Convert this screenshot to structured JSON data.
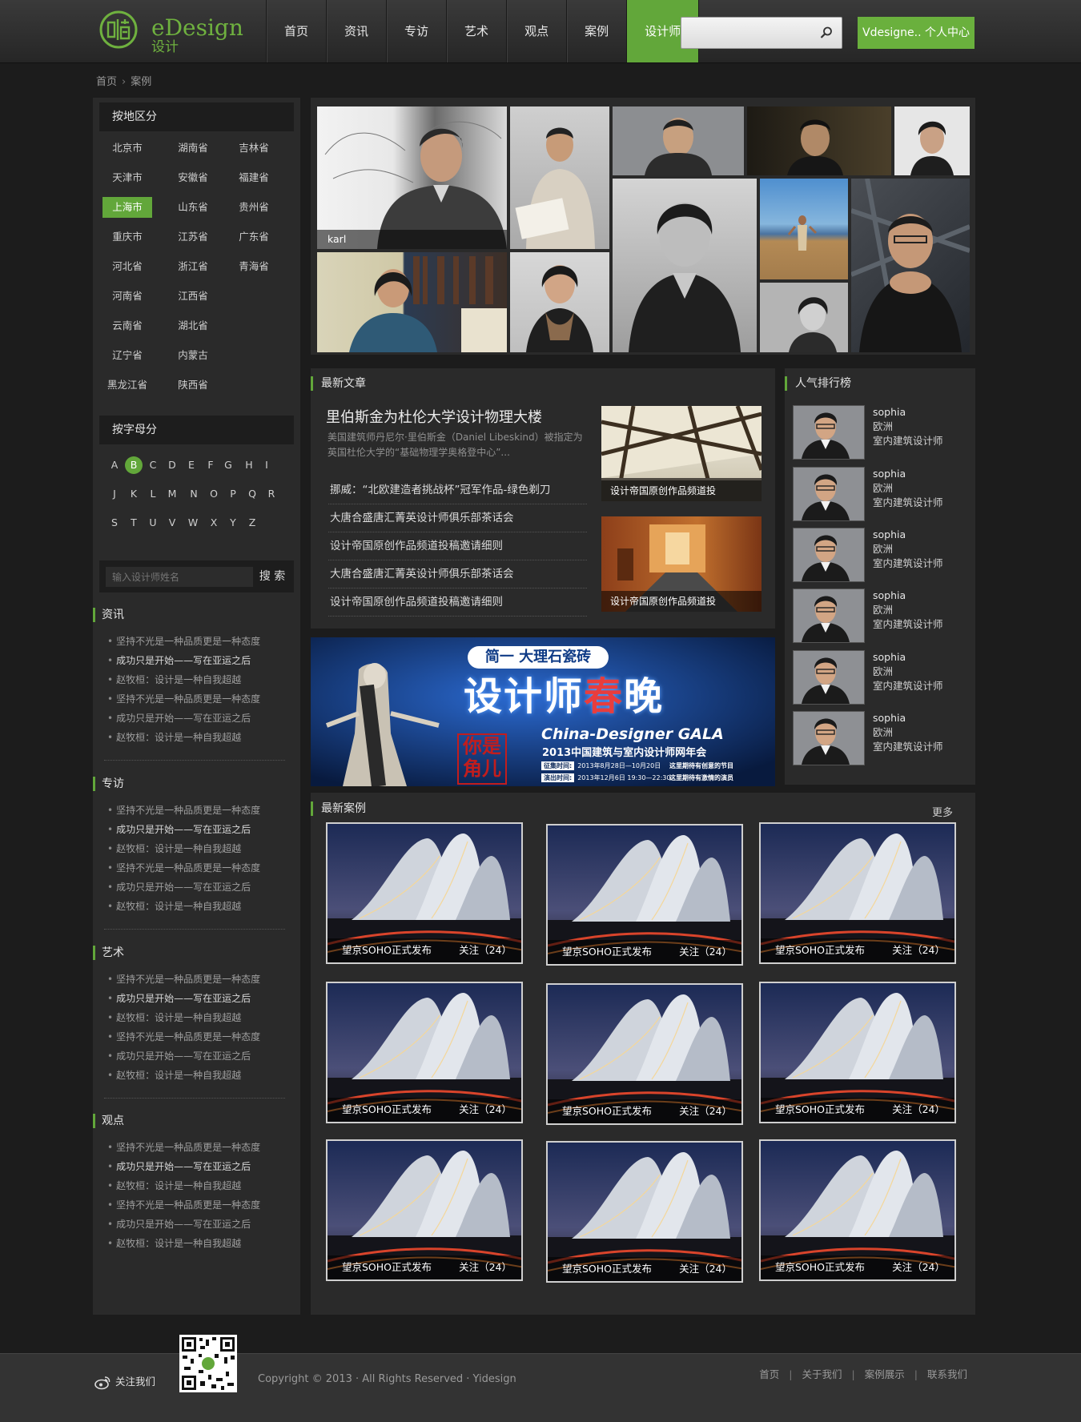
{
  "header": {
    "logo_text": "eDesign",
    "logo_sub": "设计",
    "nav": [
      "首页",
      "资讯",
      "专访",
      "艺术",
      "观点",
      "案例",
      "设计师"
    ],
    "nav_active": "设计师",
    "search_placeholder": "",
    "user_button": "Vdesigne.. 个人中心"
  },
  "breadcrumb": [
    "首页",
    "案例"
  ],
  "sidebar": {
    "region_title": "按地区分",
    "regions": [
      "北京市",
      "湖南省",
      "吉林省",
      "天津市",
      "安徽省",
      "福建省",
      "上海市",
      "山东省",
      "贵州省",
      "重庆市",
      "江苏省",
      "广东省",
      "河北省",
      "浙江省",
      "青海省",
      "河南省",
      "江西省",
      "云南省",
      "湖北省",
      "辽宁省",
      "内蒙古",
      "黑龙江省",
      "陕西省"
    ],
    "region_active": "上海市",
    "letter_title": "按字母分",
    "letters": [
      "A",
      "B",
      "C",
      "D",
      "E",
      "F",
      "G",
      "H",
      "I",
      "J",
      "K",
      "L",
      "M",
      "N",
      "O",
      "P",
      "Q",
      "R",
      "S",
      "T",
      "U",
      "V",
      "W",
      "X",
      "Y",
      "Z"
    ],
    "letter_active": "B",
    "name_search_placeholder": "输入设计师姓名",
    "name_search_button": "搜 索",
    "categories": [
      {
        "title": "资讯",
        "items": [
          "坚持不光是一种品质更是一种态度",
          "成功只是开始——写在亚运之后",
          "赵牧桓：设计是一种自我超越",
          "坚持不光是一种品质更是一种态度",
          "成功只是开始——写在亚运之后",
          "赵牧桓：设计是一种自我超越"
        ]
      },
      {
        "title": "专访",
        "items": [
          "坚持不光是一种品质更是一种态度",
          "成功只是开始——写在亚运之后",
          "赵牧桓：设计是一种自我超越",
          "坚持不光是一种品质更是一种态度",
          "成功只是开始——写在亚运之后",
          "赵牧桓：设计是一种自我超越"
        ]
      },
      {
        "title": "艺术",
        "items": [
          "坚持不光是一种品质更是一种态度",
          "成功只是开始——写在亚运之后",
          "赵牧桓：设计是一种自我超越",
          "坚持不光是一种品质更是一种态度",
          "成功只是开始——写在亚运之后",
          "赵牧桓：设计是一种自我超越"
        ]
      },
      {
        "title": "观点",
        "items": [
          "坚持不光是一种品质更是一种态度",
          "成功只是开始——写在亚运之后",
          "赵牧桓：设计是一种自我超越",
          "坚持不光是一种品质更是一种态度",
          "成功只是开始——写在亚运之后",
          "赵牧桓：设计是一种自我超越"
        ]
      }
    ]
  },
  "hero": {
    "caption": "karl"
  },
  "articles": {
    "title": "最新文章",
    "headline": "里伯斯金为杜伦大学设计物理大楼",
    "summary": "美国建筑师丹尼尔·里伯斯金（Daniel Libeskind）被指定为英国杜伦大学的“基础物理学奥格登中心”...",
    "list": [
      "挪威：“北欧建造者挑战杯”冠军作品-绿色剃刀",
      "大唐合盛唐汇菁英设计师俱乐部茶话会",
      "设计帝国原创作品频道投稿邀请细则",
      "大唐合盛唐汇菁英设计师俱乐部茶话会",
      "设计帝国原创作品频道投稿邀请细则"
    ],
    "thumbs": [
      "设计帝国原创作品频道投",
      "设计帝国原创作品频道投"
    ]
  },
  "banner": {
    "pill": "简一 大理石瓷砖",
    "big_pre": "设计师",
    "big_red": "春",
    "big_post": "晚",
    "en": "China-Designer GALA",
    "cn": "2013中国建筑与室内设计师网年会",
    "row1_tag": "征集时间:",
    "row1_date": "2013年8月28日—10月20日",
    "row1_tail": "这里期待有创意的节目",
    "row2_tag": "演出时间:",
    "row2_date": "2013年12月6日 19:30—22:30",
    "row2_tail": "这里期待有激情的演员",
    "seal": "你是角儿"
  },
  "ranking": {
    "title": "人气排行榜",
    "items": [
      {
        "name": "sophia",
        "region": "欧洲",
        "role": "室内建筑设计师"
      },
      {
        "name": "sophia",
        "region": "欧洲",
        "role": "室内建筑设计师"
      },
      {
        "name": "sophia",
        "region": "欧洲",
        "role": "室内建筑设计师"
      },
      {
        "name": "sophia",
        "region": "欧洲",
        "role": "室内建筑设计师"
      },
      {
        "name": "sophia",
        "region": "欧洲",
        "role": "室内建筑设计师"
      },
      {
        "name": "sophia",
        "region": "欧洲",
        "role": "室内建筑设计师"
      }
    ]
  },
  "cases": {
    "title": "最新案例",
    "more": "更多",
    "items": [
      {
        "title": "望京SOHO正式发布",
        "follow": "关注（24）"
      },
      {
        "title": "望京SOHO正式发布",
        "follow": "关注（24）"
      },
      {
        "title": "望京SOHO正式发布",
        "follow": "关注（24）"
      },
      {
        "title": "望京SOHO正式发布",
        "follow": "关注（24）"
      },
      {
        "title": "望京SOHO正式发布",
        "follow": "关注（24）"
      },
      {
        "title": "望京SOHO正式发布",
        "follow": "关注（24）"
      },
      {
        "title": "望京SOHO正式发布",
        "follow": "关注（24）"
      },
      {
        "title": "望京SOHO正式发布",
        "follow": "关注（24）"
      },
      {
        "title": "望京SOHO正式发布",
        "follow": "关注（24）"
      }
    ]
  },
  "footer": {
    "follow": "关注我们",
    "copyright": "Copyright © 2013 · All Rights Reserved · Yidesign",
    "links": [
      "首页",
      "关于我们",
      "案例展示",
      "联系我们"
    ]
  },
  "colors": {
    "accent": "#62a73a",
    "background": "#1c1c1c",
    "panel": "#2a2a2a"
  },
  "icons": [
    "logo-mark-icon",
    "search-icon",
    "weibo-icon",
    "qr-code-icon"
  ]
}
